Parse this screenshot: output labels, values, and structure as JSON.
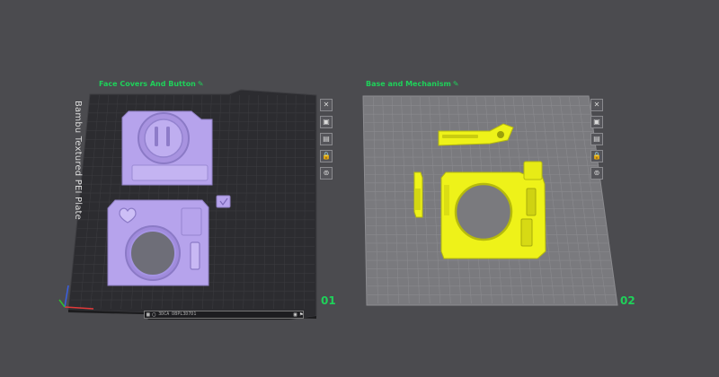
{
  "plates": [
    {
      "name": "Face Covers And Button",
      "number": "01",
      "edit_icon": "pencil-icon",
      "plate_type": "Bambu Textured PEI Plate",
      "surface": "dark textured"
    },
    {
      "name": "Base and Mechanism",
      "number": "02",
      "edit_icon": "pencil-icon",
      "surface": "light smooth"
    }
  ],
  "plate_toolbar": [
    {
      "icon": "close-icon",
      "glyph": "✕"
    },
    {
      "icon": "arrange-icon",
      "glyph": "▣"
    },
    {
      "icon": "orient-icon",
      "glyph": "▤"
    },
    {
      "icon": "lock-icon",
      "glyph": "🔒"
    },
    {
      "icon": "settings-icon",
      "glyph": "⊚"
    }
  ],
  "colors": {
    "background": "#4b4b4f",
    "plate1": "#2f2f33",
    "plate2": "#7c7c80",
    "part_purple": "#b6a3ec",
    "part_yellow": "#eef219",
    "label_green": "#1fd15a",
    "axis_x": "#e23a3a",
    "axis_y": "#2fc12f",
    "axis_z": "#3a5fe2"
  },
  "status_bar": {
    "text": "3DCA DBPL3D7D1",
    "icons": [
      "grid-icon",
      "box-icon",
      "cube-icon",
      "flag-icon"
    ]
  }
}
